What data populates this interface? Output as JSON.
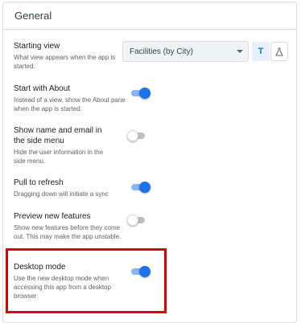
{
  "panel": {
    "title": "General"
  },
  "settings": {
    "starting_view": {
      "title": "Starting view",
      "description": "What view appears when the app is started.",
      "selected": "Facilities (by City)",
      "toggle_text_label": "T"
    },
    "start_with_about": {
      "title": "Start with About",
      "description": "Instead of a view, show the About pane when the app is started.",
      "enabled": true
    },
    "show_name_email": {
      "title": "Show name and email in the side menu",
      "description": "Hide the user information in the side menu.",
      "enabled": false
    },
    "pull_to_refresh": {
      "title": "Pull to refresh",
      "description": "Dragging down will initiate a sync",
      "enabled": true
    },
    "preview_new_features": {
      "title": "Preview new features",
      "description": "Show new features before they come out. This may make the app unstable.",
      "enabled": false
    },
    "desktop_mode": {
      "title": "Desktop mode",
      "description": "Use the new desktop mode when accessing this app from a desktop browser.",
      "enabled": true
    }
  },
  "colors": {
    "accent": "#1a73e8",
    "highlight": "#e00000"
  },
  "icons": {
    "text_mode": "text-format-icon",
    "flask": "flask-icon",
    "dropdown": "chevron-down-icon"
  }
}
